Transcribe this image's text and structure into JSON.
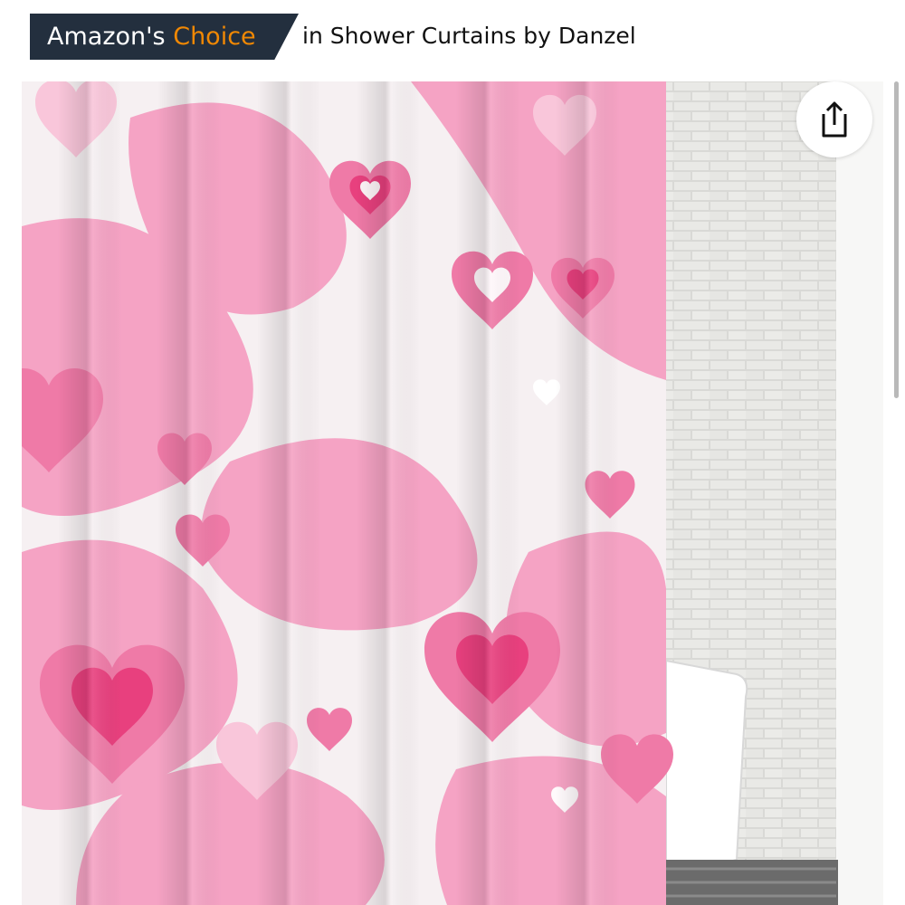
{
  "badge": {
    "prefix": "Amazon's",
    "highlight": "Choice",
    "context": "in Shower Curtains by Danzel"
  },
  "share": {
    "icon": "share-icon"
  },
  "image": {
    "subject": "pink hearts shower curtain"
  },
  "colors": {
    "badge_bg": "#232f3e",
    "badge_highlight": "#f08804",
    "pink_light": "#f7a8c8",
    "pink_mid": "#f27aa8",
    "pink_deep": "#e8407e"
  }
}
